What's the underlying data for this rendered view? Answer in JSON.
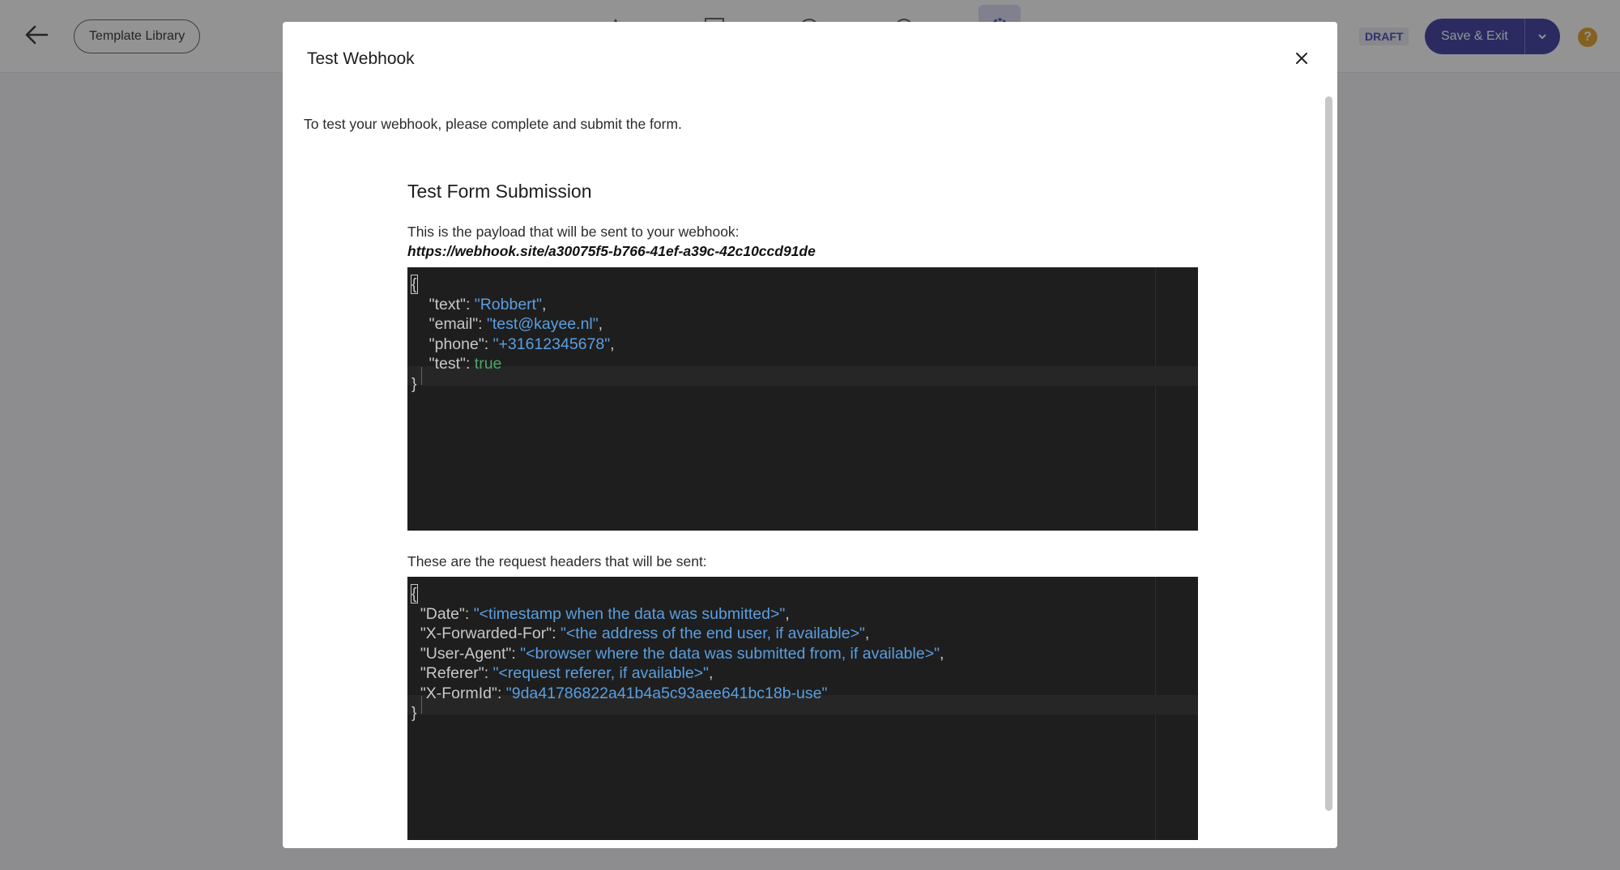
{
  "app": {
    "template_library_label": "Template Library",
    "draft_badge": "DRAFT",
    "save_exit_label": "Save & Exit",
    "help_label": "?"
  },
  "modal": {
    "title": "Test Webhook",
    "intro": "To test your webhook, please complete and submit the form.",
    "section_title": "Test Form Submission",
    "payload_label": "This is the payload that will be sent to your webhook:",
    "webhook_url": "https://webhook.site/a30075f5-b766-41ef-a39c-42c10ccd91de",
    "headers_label": "These are the request headers that will be sent:"
  },
  "payload": {
    "open": "{",
    "close": "}",
    "text_key": "\"text\"",
    "text_val": "\"Robbert\"",
    "email_key": "\"email\"",
    "email_val": "\"test@kayee.nl\"",
    "phone_key": "\"phone\"",
    "phone_val": "\"+31612345678\"",
    "test_key": "\"test\"",
    "test_val": "true"
  },
  "headers": {
    "open": "{",
    "close": "}",
    "date_key": "\"Date\"",
    "date_val": "\"<timestamp when the data was submitted>\"",
    "xff_key": "\"X-Forwarded-For\"",
    "xff_val": "\"<the address of the end user, if available>\"",
    "ua_key": "\"User-Agent\"",
    "ua_val": "\"<browser where the data was submitted from, if available>\"",
    "ref_key": "\"Referer\"",
    "ref_val": "\"<request referer, if available>\"",
    "formid_key": "\"X-FormId\"",
    "formid_val": "\"9da41786822a41b4a5c93aee641bc18b-use\""
  },
  "colors": {
    "primary": "#2e2e9c",
    "string": "#5b9fe0",
    "boolean": "#4aa66a",
    "editor_bg": "#1e1e1e"
  }
}
